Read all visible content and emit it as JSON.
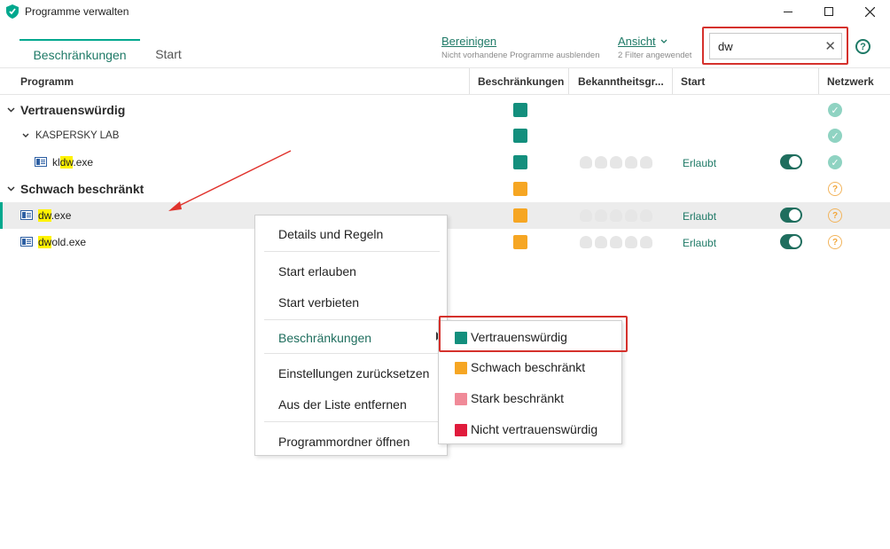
{
  "window": {
    "title": "Programme verwalten",
    "icon": "kaspersky-shield-icon",
    "controls": [
      "minimize-icon",
      "maximize-icon",
      "close-icon"
    ]
  },
  "tabs": [
    {
      "label": "Beschränkungen",
      "active": true
    },
    {
      "label": "Start",
      "active": false
    }
  ],
  "toolbar": {
    "cleanup_label": "Bereinigen",
    "cleanup_sub": "Nicht vorhandene Programme ausblenden",
    "view_label": "Ansicht",
    "view_sub": "2 Filter angewendet",
    "search_value": "dw",
    "help": "?"
  },
  "columns": [
    "Programm",
    "Beschränkungen",
    "Bekanntheitsgr...",
    "Start",
    "Netzwerk"
  ],
  "colors": {
    "trusted": "#138f7d",
    "low": "#f6a623",
    "high": "#f08a98",
    "untrusted": "#e01b3c",
    "accent": "#1f7a67"
  },
  "rows": {
    "group1": "Vertrauenswürdig",
    "vendor": "KASPERSKY LAB",
    "app1": {
      "pre": "kl",
      "hl": "dw",
      "post": ".exe",
      "start": "Erlaubt"
    },
    "group2": "Schwach beschränkt",
    "app2": {
      "pre": "",
      "hl": "dw",
      "post": ".exe",
      "start": "Erlaubt"
    },
    "app3": {
      "pre": "",
      "hl": "dw",
      "post": "old.exe",
      "start": "Erlaubt"
    }
  },
  "context_menu": {
    "items": [
      "Details und Regeln",
      "Start erlauben",
      "Start verbieten",
      "Beschränkungen",
      "Einstellungen zurücksetzen",
      "Aus der Liste entfernen",
      "Programmordner öffnen"
    ]
  },
  "submenu": {
    "items": [
      "Vertrauenswürdig",
      "Schwach beschränkt",
      "Stark beschränkt",
      "Nicht vertrauenswürdig"
    ]
  },
  "network_status": {
    "ok": "✓",
    "question": "?"
  }
}
